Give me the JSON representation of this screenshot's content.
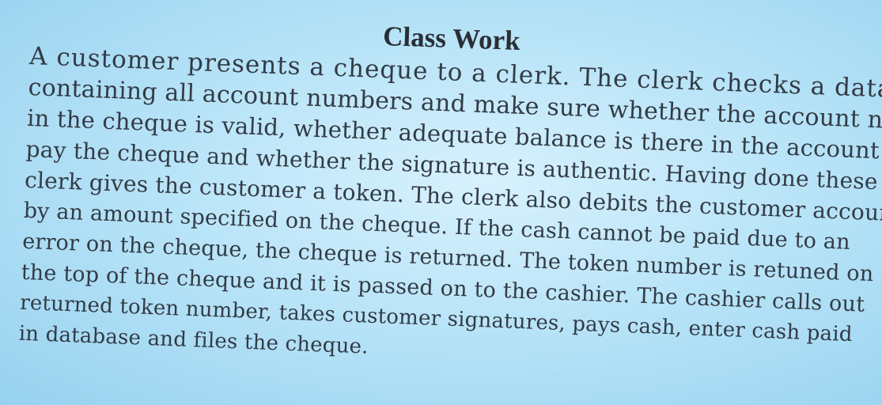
{
  "slide": {
    "title": "Class Work",
    "lines": [
      "A customer presents a cheque to a clerk. The clerk checks a database",
      "containing all account numbers and make sure whether the account number",
      "in the cheque is valid, whether adequate balance is there in the account to",
      "pay the cheque and whether the signature is authentic. Having done these the",
      "clerk gives the customer a token. The clerk also debits the customer account",
      "by an amount specified on the cheque. If the cash cannot be paid due to an",
      "error on the cheque, the cheque is returned. The token number is retuned on",
      "the top of the cheque and it is passed on to the cashier. The cashier calls out",
      "returned token number, takes customer signatures, pays cash, enter cash paid",
      "in database and files the cheque."
    ]
  }
}
